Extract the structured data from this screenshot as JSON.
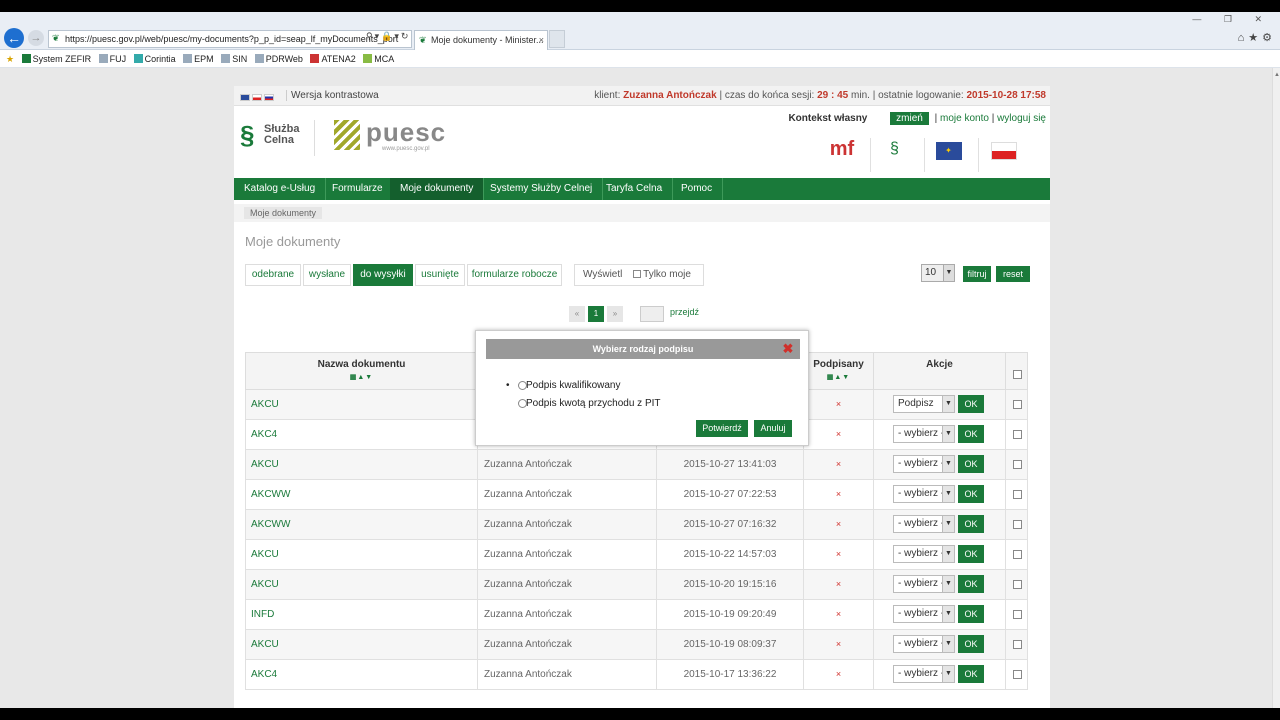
{
  "browser": {
    "url": "https://puesc.gov.pl/web/puesc/my-documents?p_p_id=seap_lf_myDocuments_port",
    "tab_title": "Moje dokumenty - Minister...",
    "favorites": [
      "System ZEFIR",
      "FUJ",
      "Corintia",
      "EPM",
      "SIN",
      "PDRWeb",
      "ATENA2",
      "MCA"
    ]
  },
  "header": {
    "contrast_label": "Wersja kontrastowa",
    "client_label": "klient:",
    "client_name": "Zuzanna Antończak",
    "session_label": "| czas do końca sesji:",
    "session_time": "29 : 45",
    "session_unit": "min. | ostatnie logowanie:",
    "last_login": "2015-10-28 17:58",
    "context_label": "Kontekst własny",
    "change_label": "zmień",
    "account_label": "moje konto",
    "logout_label": "wyloguj się",
    "logo_sc": "Służba Celna",
    "logo_puesc": "puesc",
    "logo_puesc_url": "www.puesc.gov.pl"
  },
  "nav": [
    "Katalog e-Usług",
    "Formularze",
    "Moje dokumenty",
    "Systemy Służby Celnej",
    "Taryfa Celna",
    "Pomoc"
  ],
  "breadcrumb": "Moje dokumenty",
  "page_title": "Moje dokumenty",
  "filters": {
    "tabs": [
      "odebrane",
      "wysłane",
      "do wysyłki",
      "usunięte",
      "formularze robocze"
    ],
    "show_label": "Wyświetl",
    "only_mine": "Tylko moje",
    "per_page": "10",
    "filter_btn": "filtruj",
    "reset_btn": "reset"
  },
  "pager": {
    "prev": "«",
    "current": "1",
    "next": "»",
    "goto": "przejdź"
  },
  "table": {
    "headers": {
      "name": "Nazwa dokumentu",
      "signed": "Podpisany",
      "actions": "Akcje"
    },
    "rows": [
      {
        "name": "AKCU",
        "user": "",
        "date": "",
        "action": "Podpisz"
      },
      {
        "name": "AKC4",
        "user": "",
        "date": "",
        "action": "- wybierz -"
      },
      {
        "name": "AKCU",
        "user": "Zuzanna Antończak",
        "date": "2015-10-27 13:41:03",
        "action": "- wybierz -"
      },
      {
        "name": "AKCWW",
        "user": "Zuzanna Antończak",
        "date": "2015-10-27 07:22:53",
        "action": "- wybierz -"
      },
      {
        "name": "AKCWW",
        "user": "Zuzanna Antończak",
        "date": "2015-10-27 07:16:32",
        "action": "- wybierz -"
      },
      {
        "name": "AKCU",
        "user": "Zuzanna Antończak",
        "date": "2015-10-22 14:57:03",
        "action": "- wybierz -"
      },
      {
        "name": "AKCU",
        "user": "Zuzanna Antończak",
        "date": "2015-10-20 19:15:16",
        "action": "- wybierz -"
      },
      {
        "name": "INFD",
        "user": "Zuzanna Antończak",
        "date": "2015-10-19 09:20:49",
        "action": "- wybierz -"
      },
      {
        "name": "AKCU",
        "user": "Zuzanna Antończak",
        "date": "2015-10-19 08:09:37",
        "action": "- wybierz -"
      },
      {
        "name": "AKC4",
        "user": "Zuzanna Antończak",
        "date": "2015-10-17 13:36:22",
        "action": "- wybierz -"
      }
    ],
    "ok_label": "OK",
    "unsigned_mark": "×"
  },
  "modal": {
    "title": "Wybierz rodzaj podpisu",
    "options": [
      "Podpis kwalifikowany",
      "Podpis kwotą przychodu z PIT"
    ],
    "confirm": "Potwierdź",
    "cancel": "Anuluj"
  },
  "colors": {
    "brand_green": "#1a7a3a",
    "alert_red": "#d0302b"
  }
}
